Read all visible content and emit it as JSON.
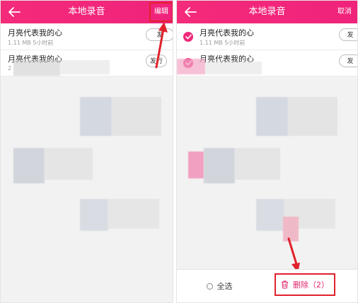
{
  "colors": {
    "brand": "#f0237b",
    "annotation": "#e0222c",
    "delete": "#e2266f"
  },
  "left": {
    "header": {
      "back_icon": "back-arrow-icon",
      "title": "本地录音",
      "edit_label": "编辑"
    },
    "items": [
      {
        "title": "月亮代表我的心",
        "meta": "1.11 MB  5小时前",
        "action": "发"
      },
      {
        "title": "月亮代表我的心",
        "meta": "2",
        "action": "发行"
      }
    ]
  },
  "right": {
    "header": {
      "back_icon": "back-arrow-icon",
      "title": "本地录音",
      "cancel_label": "取消"
    },
    "items": [
      {
        "title": "月亮代表我的心",
        "meta": "1.11 MB  5小时前",
        "action": "发",
        "checked": true
      },
      {
        "title": "月亮代表我的心",
        "meta": "",
        "action": "发",
        "checked": true
      }
    ],
    "footer": {
      "select_all_label": "全选",
      "delete_label": "删除（2）",
      "delete_icon": "trash-icon"
    }
  }
}
